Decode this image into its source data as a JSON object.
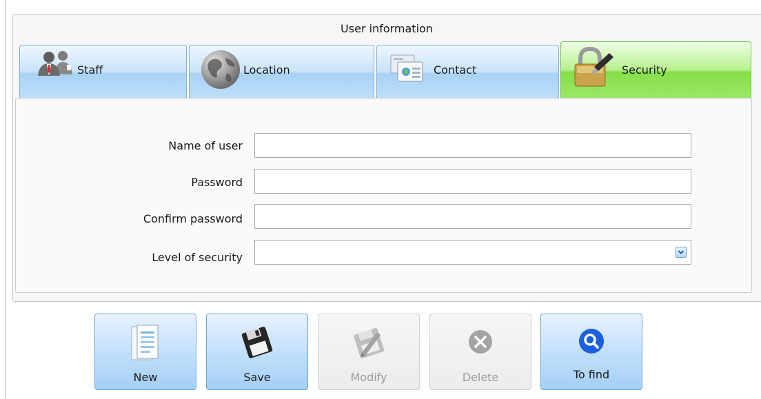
{
  "window": {
    "group_title": "User information"
  },
  "tabs": [
    {
      "label": "Staff",
      "icon": "staff-people-icon",
      "active": false
    },
    {
      "label": "Location",
      "icon": "globe-icon",
      "active": false
    },
    {
      "label": "Contact",
      "icon": "contact-cards-icon",
      "active": false
    },
    {
      "label": "Security",
      "icon": "padlock-key-icon",
      "active": true
    }
  ],
  "form": {
    "username": {
      "label": "Name of user",
      "value": ""
    },
    "password": {
      "label": "Password",
      "value": ""
    },
    "confirm_password": {
      "label": "Confirm password",
      "value": ""
    },
    "security_level": {
      "label": "Level of security",
      "value": ""
    }
  },
  "toolbar": [
    {
      "label": "New",
      "icon": "new-document-icon",
      "enabled": true
    },
    {
      "label": "Save",
      "icon": "floppy-disk-icon",
      "enabled": true
    },
    {
      "label": "Modify",
      "icon": "edit-icon",
      "enabled": false
    },
    {
      "label": "Delete",
      "icon": "delete-x-icon",
      "enabled": false
    },
    {
      "label": "To find",
      "icon": "search-icon",
      "enabled": true
    }
  ],
  "colors": {
    "tab_blue": "#bfe0fa",
    "tab_active_green": "#86df48",
    "button_blue": "#c3e0fb",
    "search_circle": "#1b5fe0"
  }
}
